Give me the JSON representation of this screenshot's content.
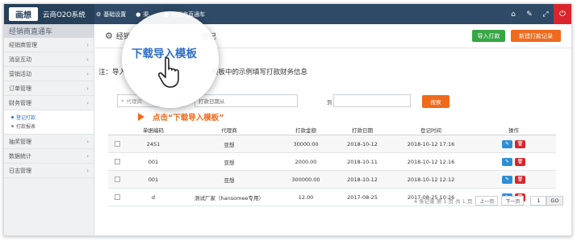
{
  "app": {
    "logo_mark": "画想",
    "logo_text": "云商O2O系统"
  },
  "topnav": [
    {
      "icon": "gear-icon",
      "glyph": "⚙",
      "label": "基础设置"
    },
    {
      "icon": "user-icon",
      "glyph": "●",
      "label": "渠..."
    },
    {
      "icon": "store-icon",
      "glyph": "●",
      "label": "经销商直通车"
    }
  ],
  "top_right": {
    "home_glyph": "⌂",
    "edit_glyph": "✎",
    "fullscreen_glyph": "⤢",
    "power_glyph": "⏻"
  },
  "sidebar": {
    "title": "经销商直通车",
    "items_top": [
      {
        "label": "经销商管理"
      },
      {
        "label": "消息互动"
      },
      {
        "label": "营销活动"
      },
      {
        "label": "订单管理"
      },
      {
        "label": "财务管理"
      }
    ],
    "sub_items": [
      {
        "label": "登记打款",
        "active": true
      },
      {
        "label": "打款报表",
        "active": false
      }
    ],
    "items_bottom": [
      {
        "label": "抽奖管理"
      },
      {
        "label": "数据统计"
      },
      {
        "label": "日志管理"
      }
    ],
    "chevron": "›"
  },
  "main": {
    "title": "经销商... 登记",
    "title_left": "经销",
    "title_right": "登记",
    "import_button": "导入打款",
    "new_button": "新建打款记录",
    "notice_prefix": "注：导入",
    "notice_suffix": "模板中的示例填写打款财务信息"
  },
  "search": {
    "agent_placeholder": "代理商",
    "date_from_label": "打款日期从",
    "date_to_label": "到",
    "search_button": "搜索"
  },
  "hint": {
    "text": "点击“下载导入模板”"
  },
  "magnifier": {
    "text": "下载导入模板"
  },
  "table": {
    "headers": [
      "单据编码",
      "代理商",
      "打款金额",
      "打款日期",
      "登记时间",
      "操作"
    ],
    "rows": [
      {
        "no": "2451",
        "agent": "亚想",
        "amount": "30000.00",
        "date": "2018-10-12",
        "reg": "2018-10-12 17:16"
      },
      {
        "no": "001",
        "agent": "亚想",
        "amount": "2000.00",
        "date": "2018-10-11",
        "reg": "2018-10-12 12:16"
      },
      {
        "no": "001",
        "agent": "亚想",
        "amount": "300000.00",
        "date": "2018-10-12",
        "reg": "2018-10-12 12:12"
      },
      {
        "no": "d",
        "agent": "测试厂家（hansomee专用）",
        "amount": "12.00",
        "date": "2017-08-25",
        "reg": "2017-08-25 10:26"
      }
    ],
    "edit_glyph": "✎",
    "delete_glyph": "🗑"
  },
  "pager": {
    "summary": "4 条记录 第 1 页 共 1 页",
    "prev": "上一页",
    "next": "下一页",
    "page_value": "1",
    "go": "GO"
  }
}
